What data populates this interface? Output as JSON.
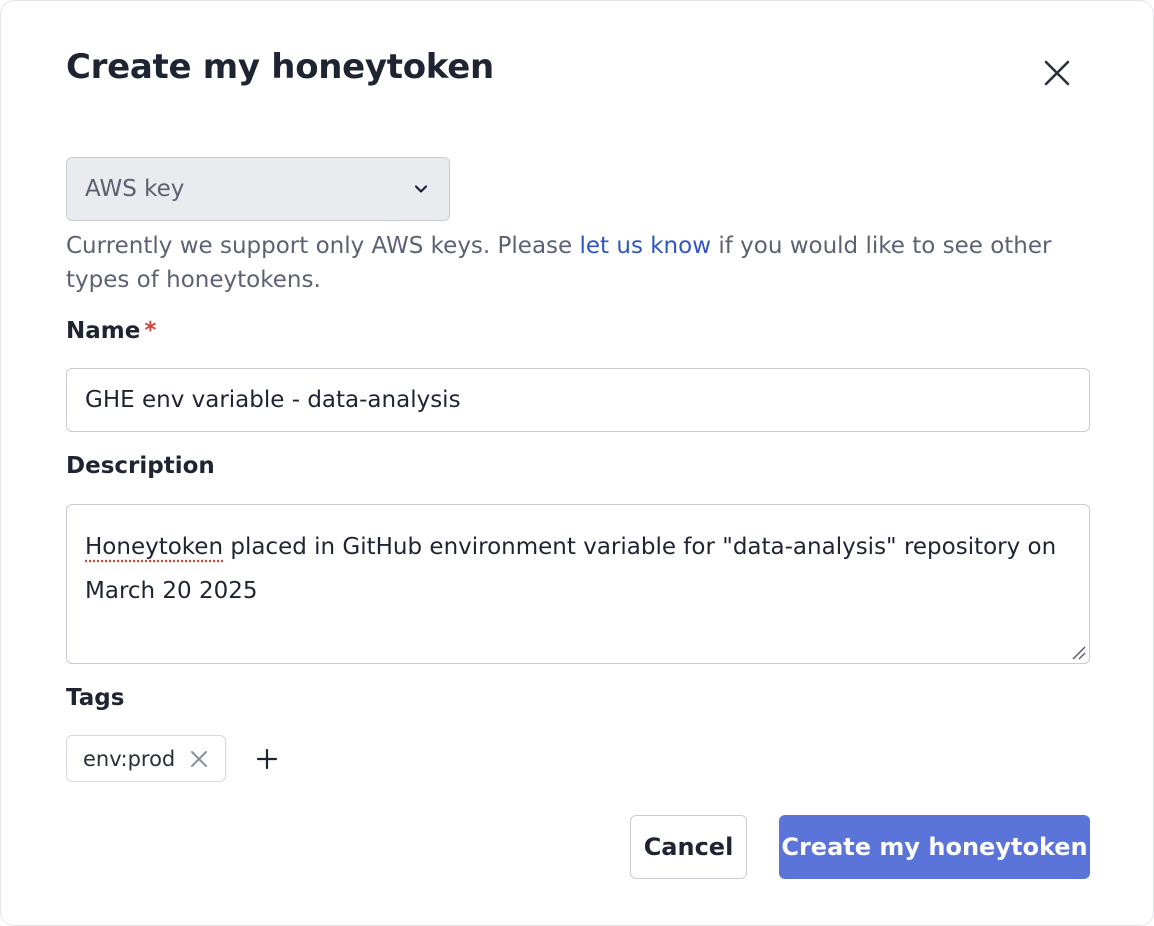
{
  "dialog": {
    "title": "Create my honeytoken",
    "close_icon": "close-icon"
  },
  "token_type": {
    "selected": "AWS key",
    "icon": "chevron-down-icon"
  },
  "help_text": {
    "before_link": "Currently we support only AWS keys. Please ",
    "link": "let us know",
    "after_link": " if you would like to see other types of honeytokens."
  },
  "name_field": {
    "label": "Name",
    "required_marker": "*",
    "value": "GHE env variable - data-analysis"
  },
  "description_field": {
    "label": "Description",
    "value_first_word": "Honeytoken",
    "value_rest": " placed in GitHub environment variable for \"data-analysis\" repository on March 20 2025"
  },
  "tags": {
    "label": "Tags",
    "items": [
      {
        "label": "env:prod",
        "remove_icon": "close-icon"
      }
    ],
    "add_icon": "plus-icon"
  },
  "actions": {
    "cancel_label": "Cancel",
    "submit_label": "Create my honeytoken",
    "submit_color": "#5a74d9"
  }
}
